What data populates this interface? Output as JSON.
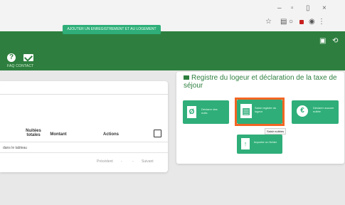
{
  "header": {
    "subnav": "FAQ CONTACT"
  },
  "left_panel": {
    "pill_label": "AJOUTER UN ENREGISTREMENT ET AU LOGEMENT",
    "col_nuitees": "Nuitées totales",
    "col_montant": "Montant",
    "col_actions": "Actions",
    "row_text": "dans le tableau",
    "pager_prev": "Précédent",
    "pager_sep1": "-",
    "pager_sep2": "-",
    "pager_next": "Suivant"
  },
  "right_panel": {
    "title": "Registre du logeur et déclaration de la taxe de séjour",
    "tiles": [
      {
        "label": "Déclarer des nuits"
      },
      {
        "label": "Saisir registre du logeur"
      },
      {
        "label": "Déclarer aucune nuitée"
      },
      {
        "label": "Importer un fichier"
      }
    ],
    "tooltip": "Saisir nuitées"
  },
  "colors": {
    "green_header": "#2e7f3f",
    "green_tile": "#2fae79",
    "highlight": "#f26522"
  }
}
